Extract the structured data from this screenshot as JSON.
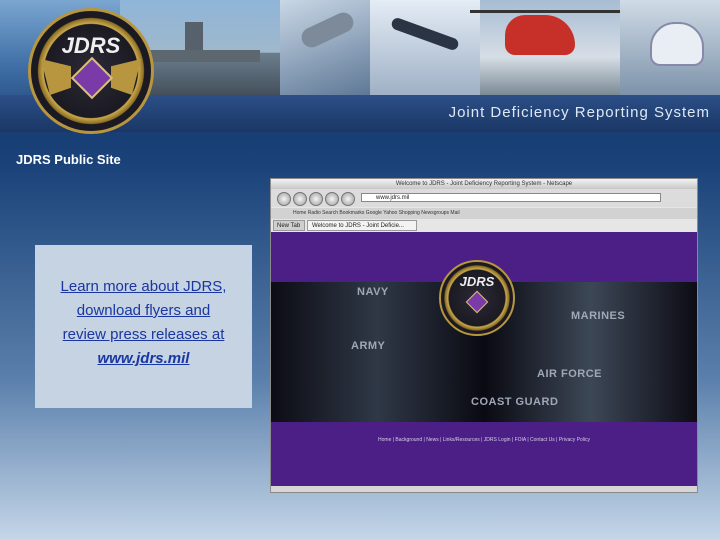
{
  "banner": {
    "title": "Joint Deficiency Reporting System",
    "logo_text": "JDRS"
  },
  "page": {
    "heading": "JDRS Public Site"
  },
  "info": {
    "lines": [
      "Learn more about JDRS,",
      "download flyers and",
      "review press releases at"
    ],
    "url": "www.jdrs.mil"
  },
  "browser": {
    "title": "Welcome to JDRS - Joint Deficiency Reporting System - Netscape",
    "url": "www.jdrs.mil",
    "bookmarks": "Home   Radio   Search   Bookmarks   Google   Yahoo   Shopping   Newsgroups   Mail",
    "tab_new": "New Tab",
    "tab_active": "Welcome to JDRS - Joint Deficie...",
    "logo_text": "JDRS",
    "services": {
      "navy": "NAVY",
      "marines": "MARINES",
      "army": "ARMY",
      "air_force": "AIR FORCE",
      "coast_guard": "COAST GUARD"
    },
    "footer": "Home | Background | News | Links/Resources | JDRS Login | FOIA | Contact Us | Privacy Policy"
  }
}
